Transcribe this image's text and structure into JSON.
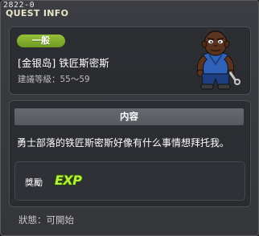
{
  "window": {
    "id_label": "2822-0",
    "title": "QUEST INFO"
  },
  "quest": {
    "category_badge": "一般",
    "name": "[金银岛] 铁匠斯密斯",
    "level_label": "建議等級：55～59"
  },
  "details": {
    "header": "内容",
    "description": "勇士部落的铁匠斯密斯好像有什么事情想拜托我。"
  },
  "reward": {
    "label": "獎勵",
    "exp_text": "EXP"
  },
  "status": {
    "text": "狀態：可開始"
  },
  "colors": {
    "badge": "#82ad2e",
    "exp": "#b6f23a",
    "panel": "#2c2e33",
    "header_bar": "#5f6268"
  }
}
